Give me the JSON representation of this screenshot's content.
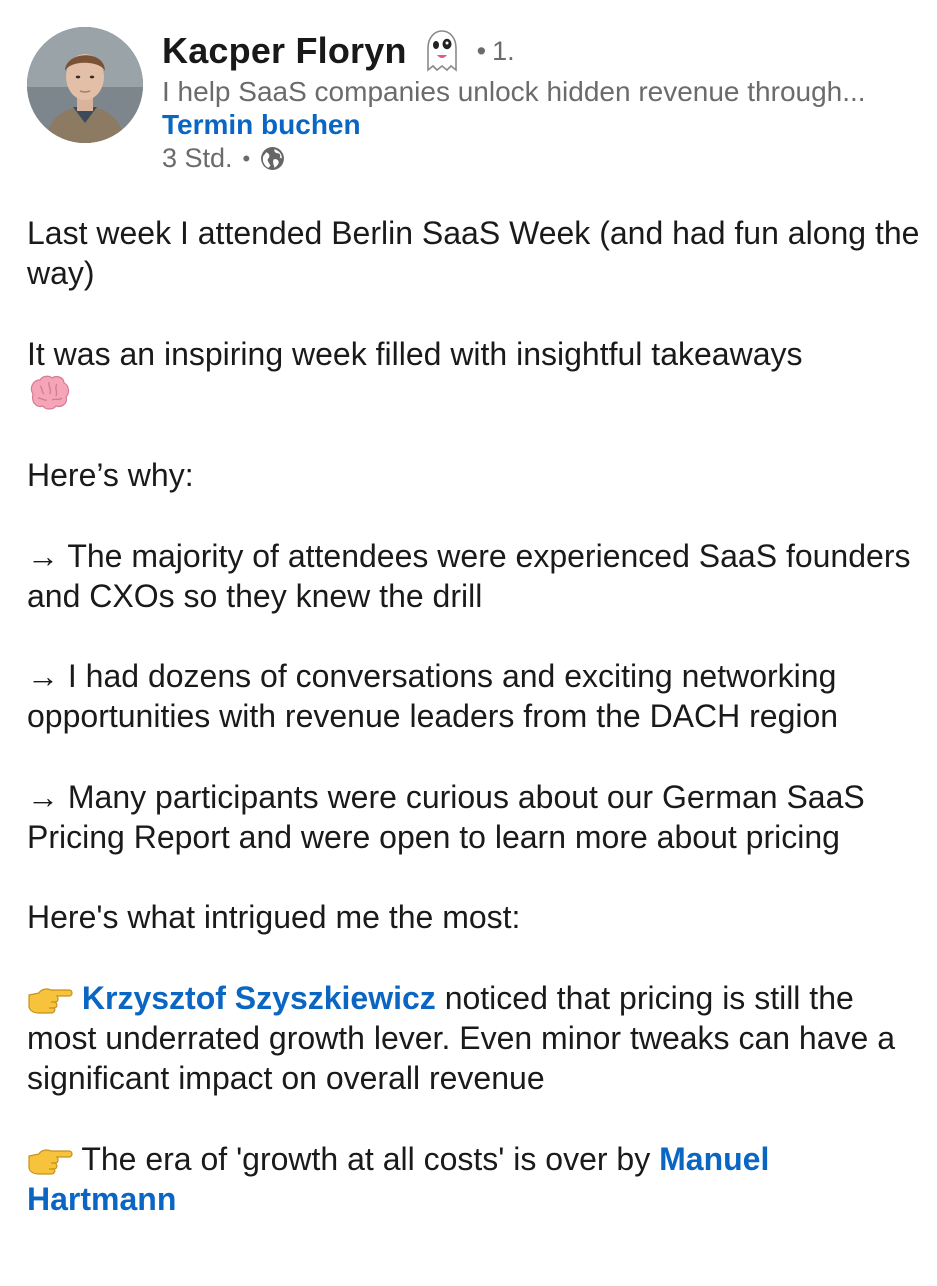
{
  "post": {
    "author": {
      "name": "Kacper Floryn",
      "degree": "1.",
      "headline": "I help SaaS companies unlock hidden revenue through...",
      "cta_label": "Termin buchen",
      "time": "3 Std."
    },
    "icons": {
      "avatar": "profile-photo",
      "name_badge": "ghost-icon",
      "visibility": "globe-icon",
      "brain": "brain-emoji",
      "pointer": "pointing-right-emoji"
    },
    "colors": {
      "link": "#0a66c2",
      "meta": "#6b6b6b",
      "text": "#1a1a1a"
    },
    "body": {
      "p1": "Last week I attended Berlin SaaS Week (and had fun along the way)",
      "p2": "It was an inspiring week filled with insightful takeaways",
      "p3": "Here’s why:",
      "p4": "→ The majority of attendees were experienced SaaS founders and CXOs so they knew the drill",
      "p5": "→ I had dozens of conversations and exciting networking opportunities with revenue leaders from the DACH region",
      "p6": "→ Many participants were curious about our German SaaS Pricing Report and were open to learn more about pricing",
      "p7": "Here's what intrigued me the most:",
      "p8_mention": "Krzysztof Szyszkiewicz",
      "p8_text": " noticed that pricing is still the most underrated growth lever. Even minor tweaks can have a significant impact on overall revenue",
      "p9_text": " The era of 'growth at all costs' is over by ",
      "p9_mention": "Manuel Hartmann"
    }
  }
}
